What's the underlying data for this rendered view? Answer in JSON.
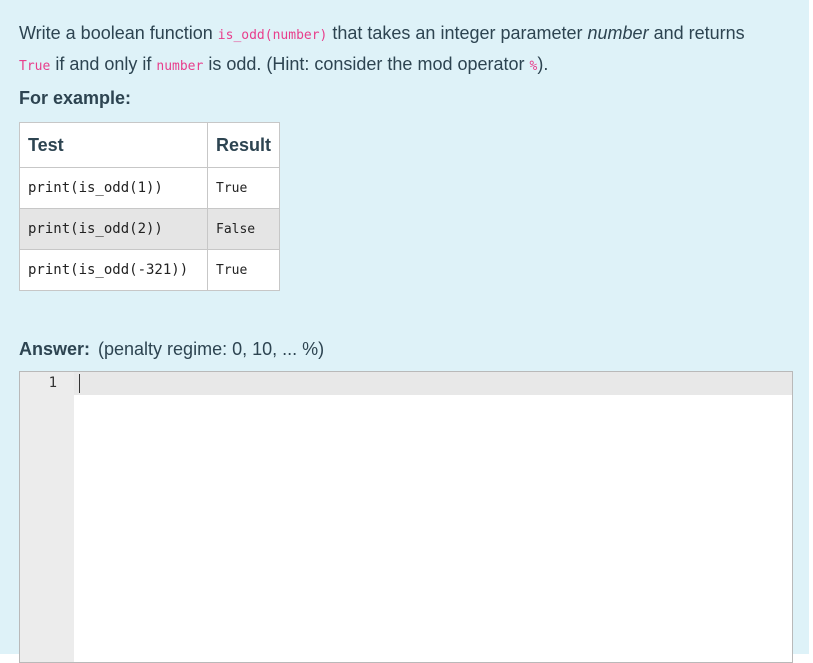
{
  "question": {
    "t1": "Write a boolean function ",
    "c1": "is_odd(number)",
    "t2": " that takes an integer parameter ",
    "e1": "number",
    "t3": " and returns",
    "c2": "True",
    "t4": " if and only if ",
    "c3": "number",
    "t5": " is odd. (Hint: consider the mod operator ",
    "c4": "%",
    "t6": ")."
  },
  "for_example": "For example:",
  "table": {
    "headers": [
      "Test",
      "Result"
    ],
    "rows": [
      {
        "test": "print(is_odd(1))",
        "result": "True"
      },
      {
        "test": "print(is_odd(2))",
        "result": "False"
      },
      {
        "test": "print(is_odd(-321))",
        "result": "True"
      }
    ]
  },
  "answer": {
    "label": "Answer:",
    "penalty": "(penalty regime: 0, 10, ... %)"
  },
  "editor": {
    "line_number": "1"
  }
}
